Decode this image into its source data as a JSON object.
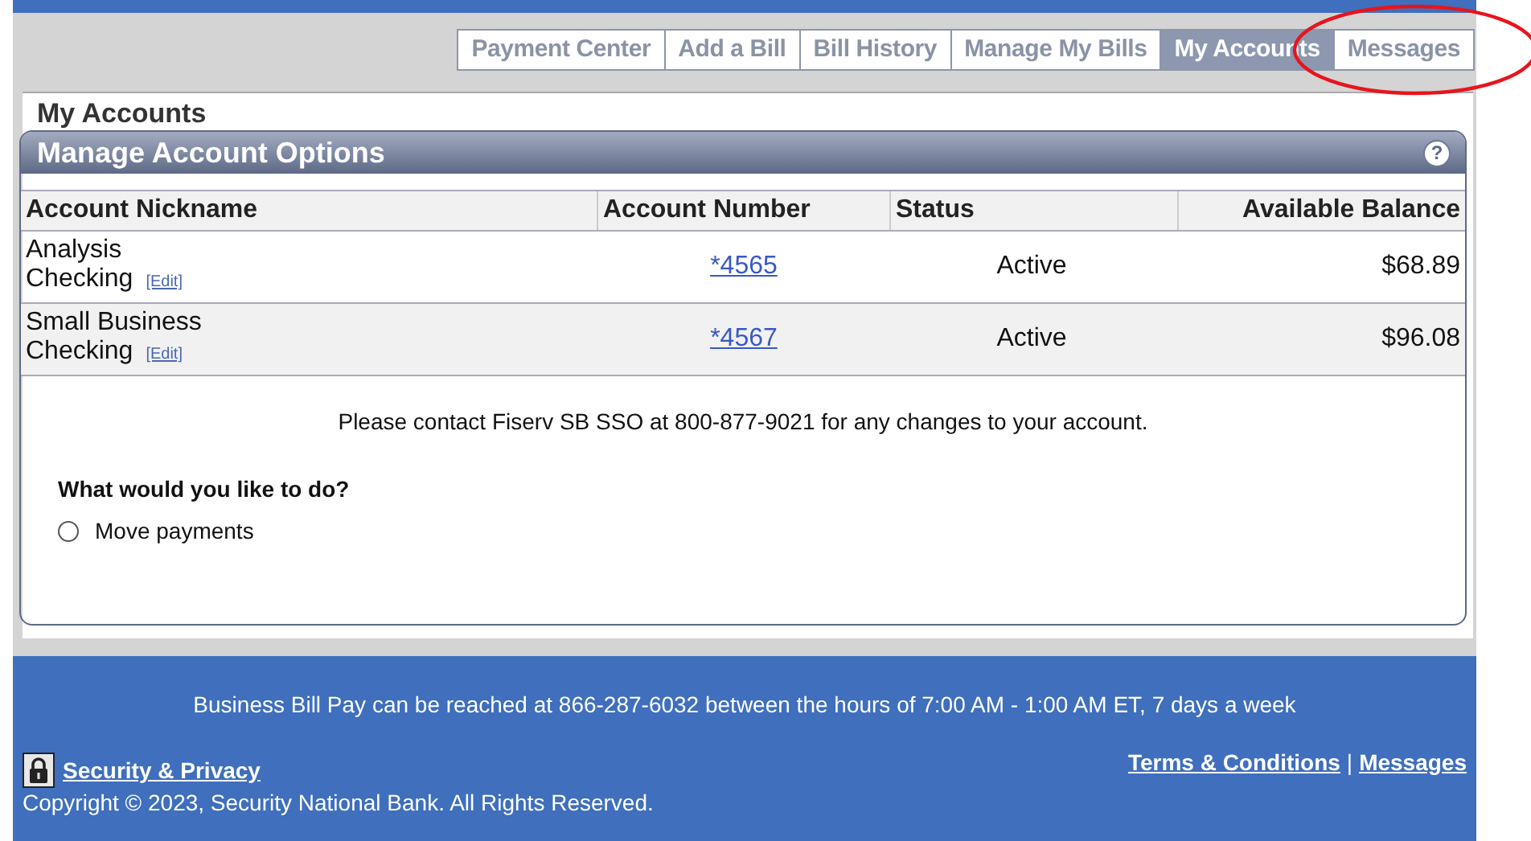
{
  "tabs": [
    {
      "label": "Payment Center",
      "selected": false
    },
    {
      "label": "Add a Bill",
      "selected": false
    },
    {
      "label": "Bill History",
      "selected": false
    },
    {
      "label": "Manage My Bills",
      "selected": false
    },
    {
      "label": "My Accounts",
      "selected": true
    },
    {
      "label": "Messages",
      "selected": false
    }
  ],
  "highlight": {
    "kind": "ellipse"
  },
  "page_title": "My Accounts",
  "section": {
    "title": "Manage Account Options",
    "help": "?"
  },
  "table": {
    "columns": [
      "Account Nickname",
      "Account Number",
      "Status",
      "Available Balance"
    ],
    "rows": [
      {
        "nickname": [
          "Analysis",
          "Checking"
        ],
        "edit": "[Edit]",
        "number": "*4565",
        "status": "Active",
        "balance": "$68.89"
      },
      {
        "nickname": [
          "Small Business",
          "Checking"
        ],
        "edit": "[Edit]",
        "number": "*4567",
        "status": "Active",
        "balance": "$96.08"
      }
    ]
  },
  "notice": "Please contact Fiserv SB SSO at 800-877-9021 for any changes to your account.",
  "question": "What would you like to do?",
  "options": [
    {
      "label": "Move payments",
      "selected": false
    }
  ],
  "footer": {
    "hours": "Business Bill Pay can be reached at 866-287-6032 between the hours of 7:00 AM - 1:00 AM ET, 7 days a week",
    "security_link": "Security & Privacy",
    "terms_link": "Terms & Conditions",
    "separator": "|",
    "messages_link": "Messages",
    "copyright": "Copyright © 2023, Security National Bank. All Rights Reserved."
  }
}
